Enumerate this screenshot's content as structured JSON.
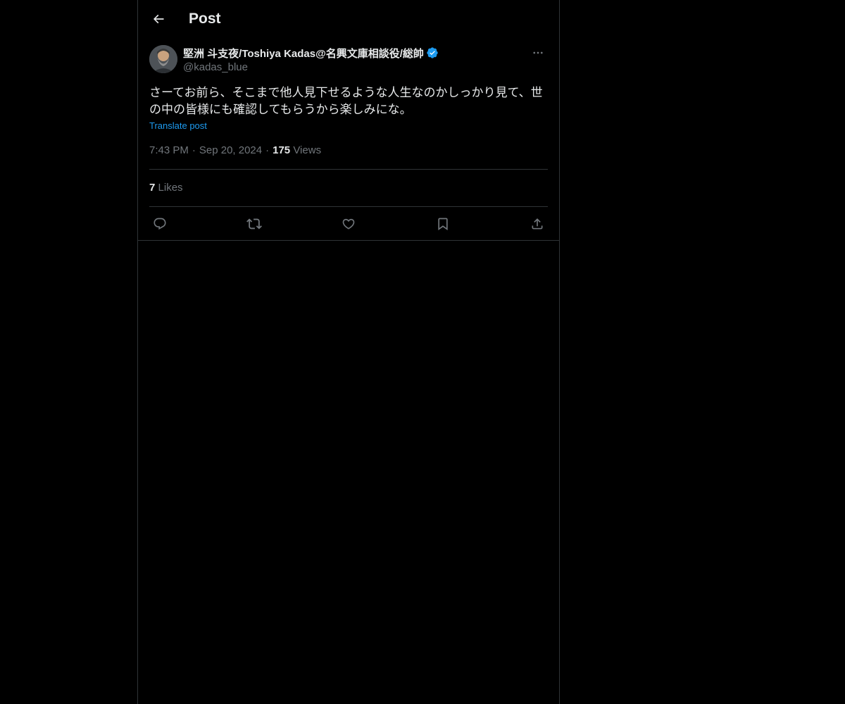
{
  "header": {
    "title": "Post",
    "back_icon": "arrow-left-icon"
  },
  "post": {
    "author": {
      "display_name": "堅洲 斗支夜/Toshiya Kadas@名興文庫相談役/総帥",
      "handle": "@kadas_blue",
      "verified": true
    },
    "text": "さーてお前ら、そこまで他人見下せるような人生なのかしっかり見て、世の中の皆様にも確認してもらうから楽しみにな。",
    "translate_label": "Translate post",
    "time": "7:43 PM",
    "separator": "·",
    "date": "Sep 20, 2024",
    "views_count": "175",
    "views_label": "Views",
    "likes_count": "7",
    "likes_label": "Likes"
  },
  "actions": [
    "reply-icon",
    "repost-icon",
    "like-icon",
    "bookmark-icon",
    "share-icon"
  ],
  "colors": {
    "background": "#000000",
    "text": "#e7e9ea",
    "secondary_text": "#71767b",
    "accent": "#1d9bf0",
    "border": "#2f3336"
  }
}
